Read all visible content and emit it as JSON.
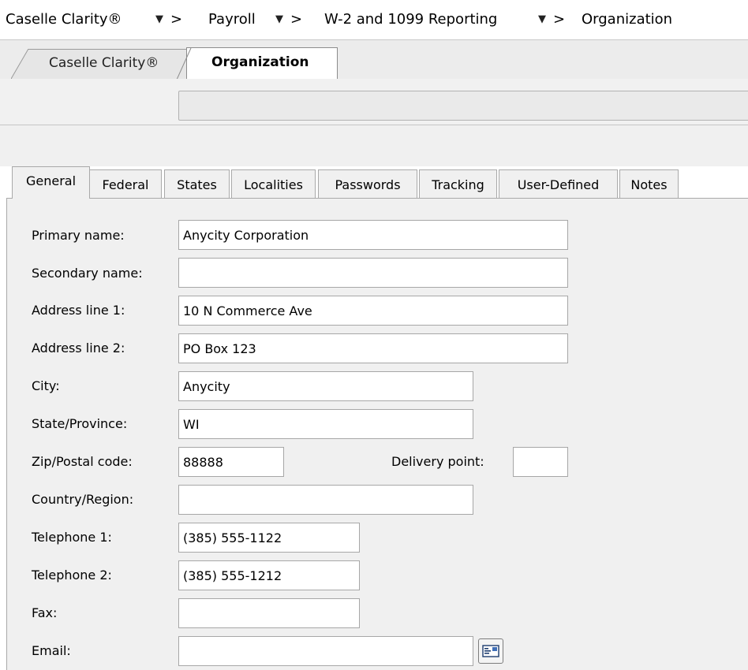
{
  "breadcrumb": {
    "items": [
      "Caselle Clarity®",
      "Payroll",
      "W-2 and 1099 Reporting",
      "Organization"
    ],
    "arrow": "▼",
    "separator": ">"
  },
  "doc_tabs": [
    {
      "label": "Caselle Clarity®",
      "active": false
    },
    {
      "label": "Organization",
      "active": true
    }
  ],
  "toolbar": {
    "input_value": ""
  },
  "tabs": [
    {
      "label": "General",
      "active": true
    },
    {
      "label": "Federal"
    },
    {
      "label": "States"
    },
    {
      "label": "Localities"
    },
    {
      "label": "Passwords"
    },
    {
      "label": "Tracking"
    },
    {
      "label": "User-Defined"
    },
    {
      "label": "Notes"
    }
  ],
  "form": {
    "primary_name": {
      "label": "Primary name:",
      "value": "Anycity Corporation"
    },
    "secondary_name": {
      "label": "Secondary name:",
      "value": ""
    },
    "address1": {
      "label": "Address line 1:",
      "value": "10 N Commerce Ave"
    },
    "address2": {
      "label": "Address line 2:",
      "value": "PO Box 123"
    },
    "city": {
      "label": "City:",
      "value": "Anycity"
    },
    "state": {
      "label": "State/Province:",
      "value": "WI"
    },
    "zip": {
      "label": "Zip/Postal code:",
      "value": "88888"
    },
    "delivery_point": {
      "label": "Delivery point:",
      "value": ""
    },
    "country": {
      "label": "Country/Region:",
      "value": ""
    },
    "telephone1": {
      "label": "Telephone 1:",
      "value": "(385) 555-1122"
    },
    "telephone2": {
      "label": "Telephone 2:",
      "value": "(385) 555-1212"
    },
    "fax": {
      "label": "Fax:",
      "value": ""
    },
    "email": {
      "label": "Email:",
      "value": ""
    }
  },
  "icons": {
    "email_button": "email-envelope-icon"
  },
  "colors": {
    "panel_bg": "#f0f0f0",
    "tab_border": "#a9a9a9",
    "field_border": "#a7a7a7"
  }
}
